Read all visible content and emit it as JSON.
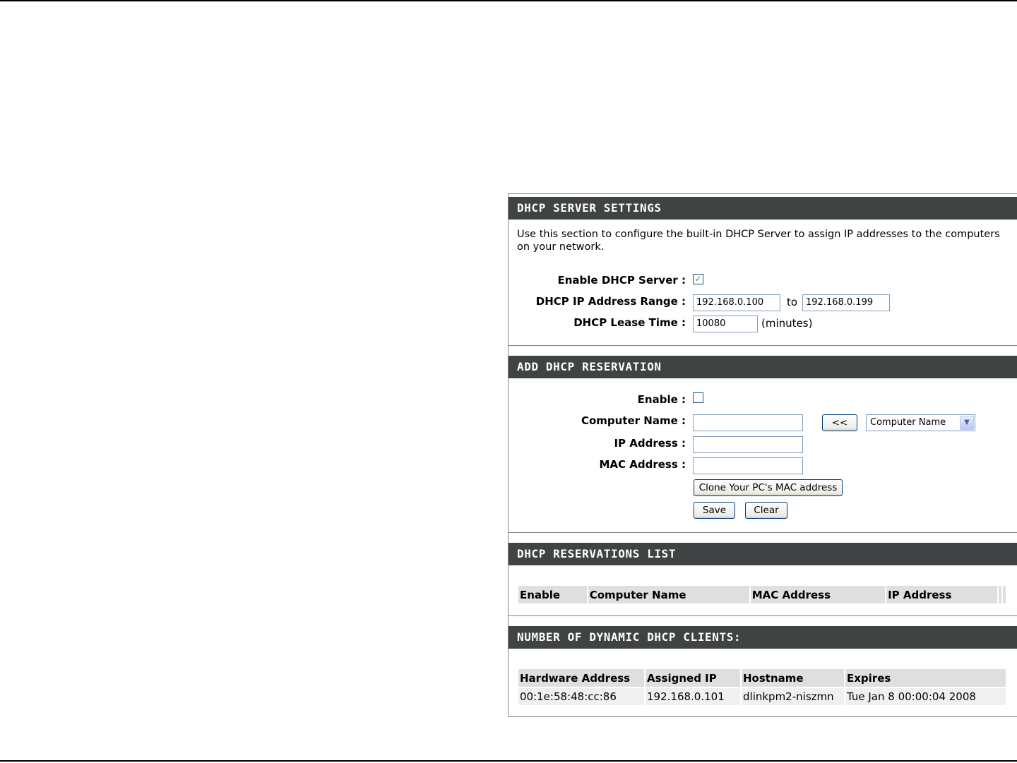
{
  "dhcp_server": {
    "title": "DHCP SERVER SETTINGS",
    "description": "Use this section to configure the built-in DHCP Server to assign IP addresses to the computers on your network.",
    "enable_label": "Enable DHCP Server :",
    "enable_checked": true,
    "range_label": "DHCP IP Address Range :",
    "range_start": "192.168.0.100",
    "range_to": "to",
    "range_end": "192.168.0.199",
    "lease_label": "DHCP Lease Time :",
    "lease_value": "10080",
    "lease_unit": "(minutes)"
  },
  "add_reservation": {
    "title": "ADD DHCP RESERVATION",
    "enable_label": "Enable :",
    "enable_checked": false,
    "computer_name_label": "Computer Name :",
    "computer_name_value": "",
    "copy_button": "<<",
    "computer_select_value": "Computer Name",
    "ip_label": "IP Address :",
    "ip_value": "",
    "mac_label": "MAC Address :",
    "mac_value": "",
    "clone_button": "Clone Your PC's MAC address",
    "save_button": "Save",
    "clear_button": "Clear"
  },
  "reservations_list": {
    "title": "DHCP RESERVATIONS LIST",
    "columns": [
      "Enable",
      "Computer Name",
      "MAC Address",
      "IP Address"
    ]
  },
  "dynamic_clients": {
    "title": "NUMBER OF DYNAMIC DHCP CLIENTS:",
    "columns": [
      "Hardware Address",
      "Assigned IP",
      "Hostname",
      "Expires"
    ],
    "rows": [
      [
        "00:1e:58:48:cc:86",
        "192.168.0.101",
        "dlinkpm2-niszmn",
        "Tue Jan 8 00:00:04 2008"
      ]
    ]
  },
  "colors": {
    "section_header_bg": "#404343",
    "table_header_bg": "#dfdfdf",
    "table_row_bg": "#f0f0f0",
    "checkmark": "#21a121"
  }
}
